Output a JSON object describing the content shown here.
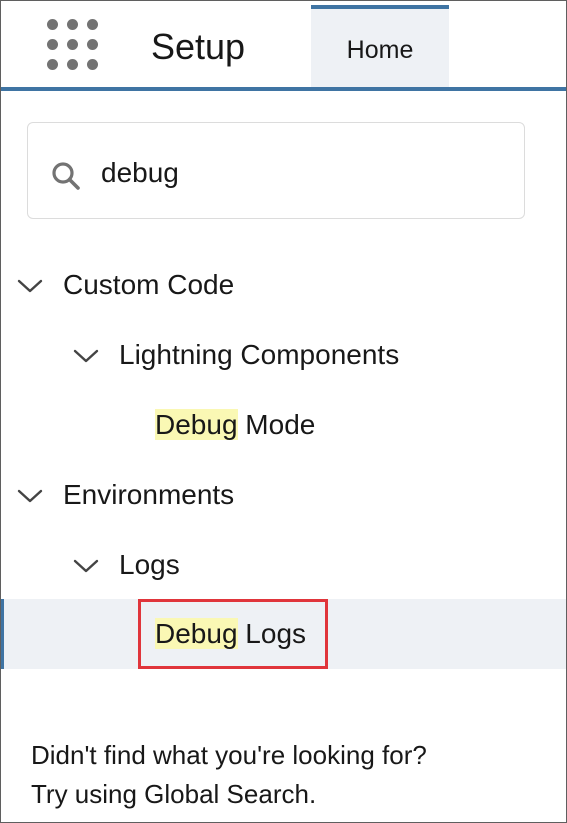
{
  "header": {
    "title": "Setup",
    "app_launcher_icon": "grid-icon",
    "tabs": [
      {
        "label": "Home",
        "active": true
      }
    ],
    "accent_color": "#3f74a3"
  },
  "search": {
    "value": "debug",
    "icon": "search-icon"
  },
  "tree": {
    "highlight_color": "#faf8b4",
    "items": [
      {
        "label": "Custom Code",
        "level": 1,
        "expanded": true
      },
      {
        "label": "Lightning Components",
        "level": 2,
        "expanded": true
      },
      {
        "match": "Debug",
        "rest": " Mode",
        "level": 3
      },
      {
        "label": "Environments",
        "level": 1,
        "expanded": true
      },
      {
        "label": "Logs",
        "level": 2,
        "expanded": true
      },
      {
        "match": "Debug",
        "rest": " Logs",
        "level": 3,
        "selected": true
      }
    ]
  },
  "hint": {
    "line1": "Didn't find what you're looking for?",
    "line2": "Try using Global Search."
  }
}
